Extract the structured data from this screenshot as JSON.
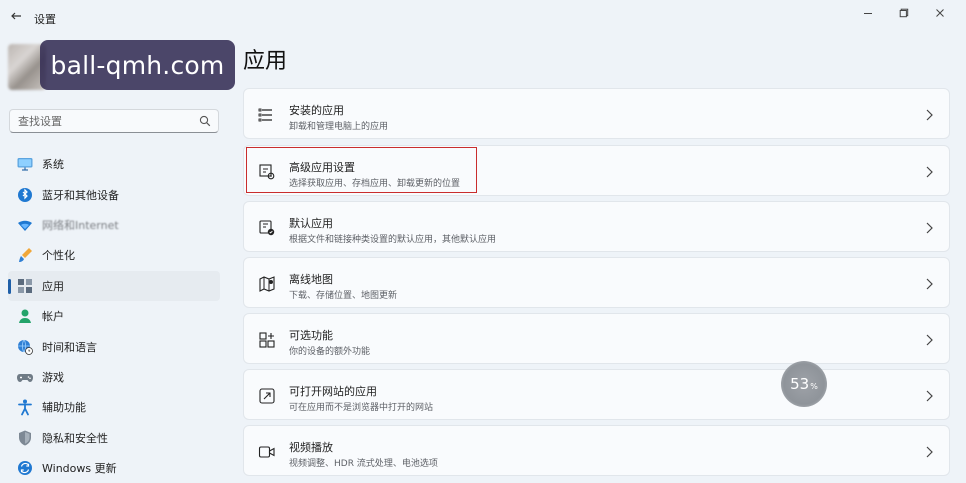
{
  "window": {
    "title": "设置"
  },
  "watermark": {
    "text": "ball-qmh.com"
  },
  "page": {
    "title": "应用"
  },
  "search": {
    "placeholder": "查找设置"
  },
  "sidebar": {
    "items": [
      {
        "label": "系统",
        "icon": "monitor-icon"
      },
      {
        "label": "蓝牙和其他设备",
        "icon": "bluetooth-icon"
      },
      {
        "label": "网络和Internet",
        "icon": "wifi-icon",
        "blurred": true
      },
      {
        "label": "个性化",
        "icon": "brush-icon"
      },
      {
        "label": "应用",
        "icon": "apps-icon",
        "active": true
      },
      {
        "label": "帐户",
        "icon": "account-icon"
      },
      {
        "label": "时间和语言",
        "icon": "globe-clock-icon"
      },
      {
        "label": "游戏",
        "icon": "gamepad-icon"
      },
      {
        "label": "辅助功能",
        "icon": "accessibility-icon"
      },
      {
        "label": "隐私和安全性",
        "icon": "shield-icon"
      },
      {
        "label": "Windows 更新",
        "icon": "update-icon"
      }
    ]
  },
  "cards": [
    {
      "title": "安装的应用",
      "subtitle": "卸载和管理电脑上的应用",
      "icon": "installed-apps-icon"
    },
    {
      "title": "高级应用设置",
      "subtitle": "选择获取应用、存档应用、卸载更新的位置",
      "icon": "advanced-apps-icon"
    },
    {
      "title": "默认应用",
      "subtitle": "根据文件和链接种类设置的默认应用，其他默认应用",
      "icon": "default-apps-icon"
    },
    {
      "title": "离线地图",
      "subtitle": "下载、存储位置、地图更新",
      "icon": "offline-maps-icon"
    },
    {
      "title": "可选功能",
      "subtitle": "你的设备的额外功能",
      "icon": "optional-features-icon"
    },
    {
      "title": "可打开网站的应用",
      "subtitle": "可在应用而不是浏览器中打开的网站",
      "icon": "website-apps-icon"
    },
    {
      "title": "视频播放",
      "subtitle": "视频调整、HDR 流式处理、电池选项",
      "icon": "video-playback-icon"
    }
  ],
  "loading": {
    "value": "53",
    "unit": "%"
  },
  "colors": {
    "accent": "#1f5fa8",
    "highlight_border": "#c92d2d",
    "window_background": "#eef3f8",
    "card_background": "#f9fbfd"
  }
}
